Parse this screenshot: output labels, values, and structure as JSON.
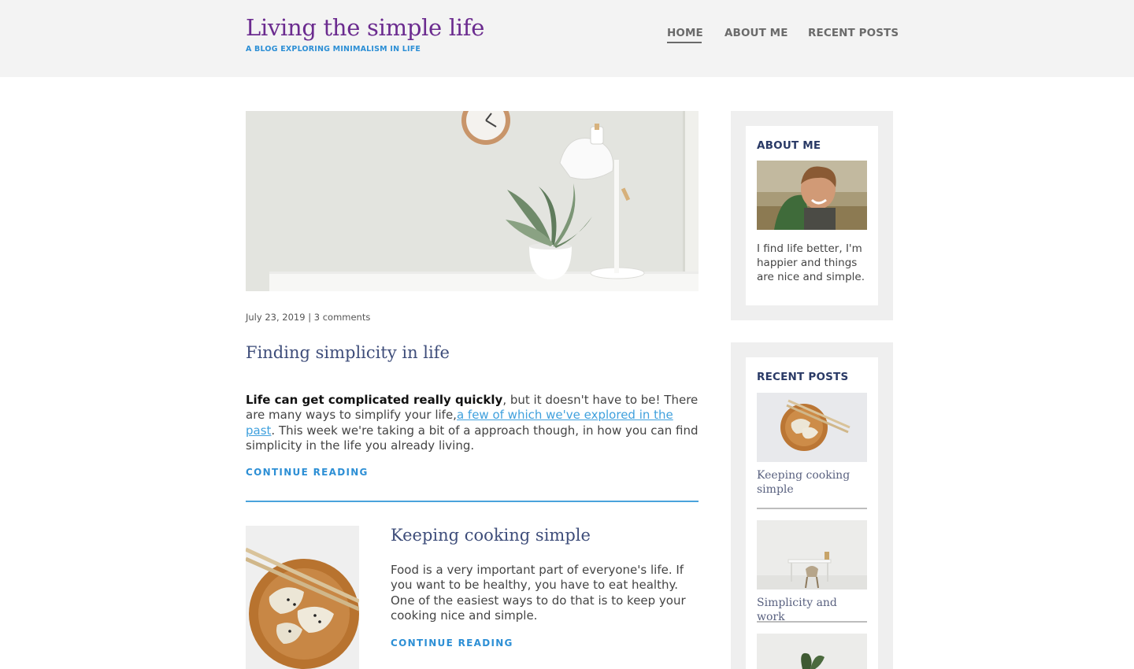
{
  "site": {
    "title": "Living the simple life",
    "tagline": "A BLOG EXPLORING MINIMALISM IN LIFE"
  },
  "nav": {
    "items": [
      {
        "label": "HOME",
        "active": true
      },
      {
        "label": "ABOUT ME",
        "active": false
      },
      {
        "label": "RECENT POSTS",
        "active": false
      }
    ]
  },
  "posts": {
    "featured": {
      "meta": "July 23, 2019 | 3 comments",
      "title": "Finding simplicity in life",
      "excerpt_bold": "Life can get complicated really quickly",
      "excerpt_part1": ", but it doesn't have to be! There are many ways to simplify your life,",
      "excerpt_link": "a few of which we've explored in the past",
      "excerpt_part2": ". This week we're taking a bit of a approach though, in how you can find simplicity in the life you already living.",
      "continue_label": "CONTINUE READING"
    },
    "second": {
      "title": "Keeping cooking simple",
      "excerpt": "Food is a very important part of everyone's life. If you want to be healthy, you have to eat healthy. One of the easiest ways to do that is to keep your cooking nice and simple.",
      "continue_label": "CONTINUE READING"
    }
  },
  "sidebar": {
    "about": {
      "title": "ABOUT ME",
      "text": "I find life better, I'm happier and things are nice and simple."
    },
    "recent": {
      "title": "RECENT POSTS",
      "items": [
        {
          "label": "Keeping cooking simple"
        },
        {
          "label": "Simplicity and work"
        }
      ]
    }
  },
  "colors": {
    "brand_purple": "#6b2b8f",
    "accent_blue": "#2d8fd5",
    "title_navy": "#3e4d7a",
    "widget_bg": "#efefef"
  }
}
